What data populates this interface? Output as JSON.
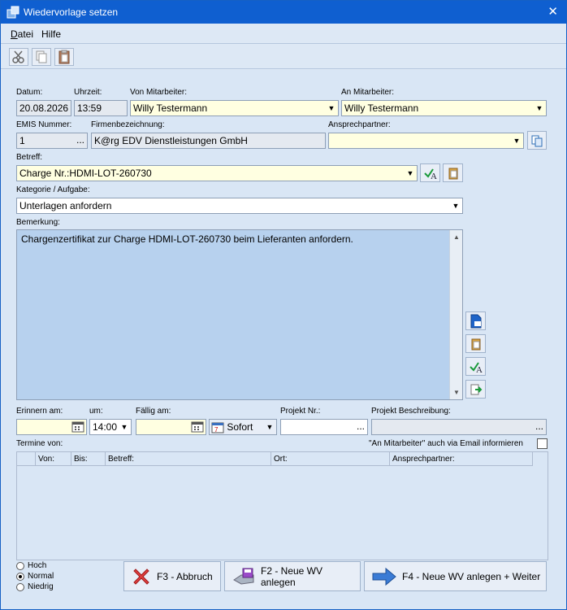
{
  "window": {
    "title": "Wiedervorlage setzen"
  },
  "menu": {
    "datei": "Datei",
    "hilfe": "Hilfe"
  },
  "form": {
    "datum_label": "Datum:",
    "datum_value": "20.08.2026",
    "uhrzeit_label": "Uhrzeit:",
    "uhrzeit_value": "13:59",
    "von_label": "Von Mitarbeiter:",
    "von_value": "Willy Testermann",
    "an_label": "An Mitarbeiter:",
    "an_value": "Willy Testermann",
    "emis_label": "EMIS Nummer:",
    "emis_value": "1",
    "firma_label": "Firmenbezeichnung:",
    "firma_value": "K@rg EDV Dienstleistungen GmbH",
    "ansprech_label": "Ansprechpartner:",
    "ansprech_value": "",
    "betreff_label": "Betreff:",
    "betreff_value": "Charge Nr.:HDMI-LOT-260730",
    "kategorie_label": "Kategorie / Aufgabe:",
    "kategorie_value": "Unterlagen anfordern",
    "bemerkung_label": "Bemerkung:",
    "bemerkung_value": "Chargenzertifikat zur Charge HDMI-LOT-260730 beim Lieferanten anfordern.",
    "erinnern_label": "Erinnern am:",
    "erinnern_value": "",
    "um_label": "um:",
    "um_value": "14:00",
    "faellig_label": "Fällig am:",
    "faellig_value": "",
    "sofort_label": "Sofort",
    "projekt_nr_label": "Projekt Nr.:",
    "projekt_nr_value": "",
    "projekt_beschr_label": "Projekt Beschreibung:",
    "projekt_beschr_value": "",
    "termine_label": "Termine von:",
    "email_info_label": "\"An Mitarbeiter\" auch via Email informieren",
    "dots": "..."
  },
  "grid": {
    "columns": [
      "Von:",
      "Bis:",
      "Betreff:",
      "Ort:",
      "Ansprechpartner:"
    ]
  },
  "priority": {
    "options": [
      "Hoch",
      "Normal",
      "Niedrig"
    ],
    "selected": "Normal"
  },
  "buttons": {
    "abbruch": "F3 - Abbruch",
    "neue_wv": "F2 - Neue WV anlegen",
    "neue_wv_weiter": "F4 - Neue WV anlegen + Weiter"
  },
  "colors": {
    "accent": "#0f5fd0",
    "required_field": "#ffffe1",
    "memo_bg": "#b7d1ee"
  }
}
